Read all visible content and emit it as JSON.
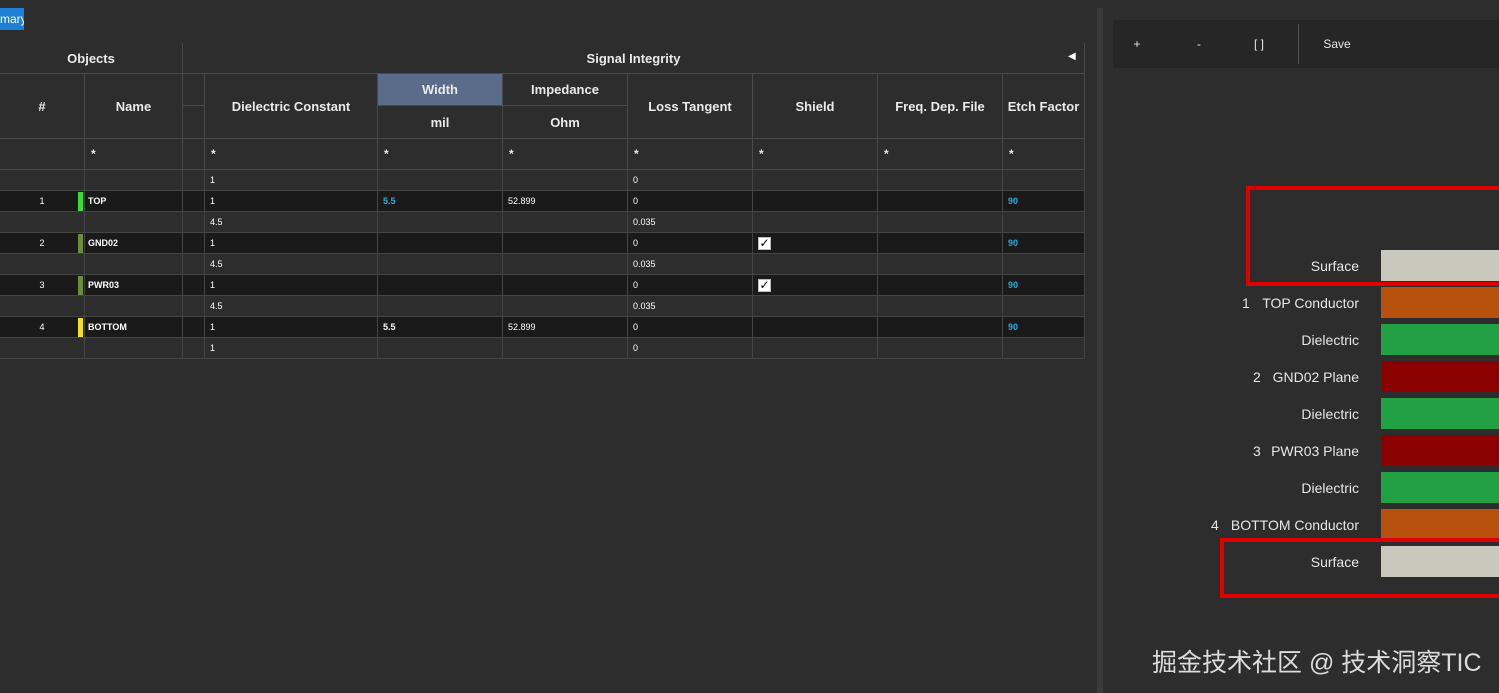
{
  "tab_label": "mary",
  "grid": {
    "group_objects": "Objects",
    "group_signal": "Signal Integrity",
    "col_num": "#",
    "col_name": "Name",
    "col_dk": "Dielectric Constant",
    "col_width": "Width",
    "col_width_unit": "mil",
    "col_imp": "Impedance",
    "col_imp_unit": "Ohm",
    "col_loss": "Loss Tangent",
    "col_shield": "Shield",
    "col_freq": "Freq. Dep. File",
    "col_etch": "Etch Factor",
    "filter": "*",
    "rows": [
      {
        "num": "",
        "name": "",
        "dk": "1",
        "width": "",
        "imp": "",
        "loss": "0",
        "etch": ""
      },
      {
        "num": "1",
        "name": "TOP",
        "dk": "1",
        "width": "5.5",
        "imp": "52.899",
        "loss": "0",
        "etch": "90"
      },
      {
        "num": "",
        "name": "",
        "dk": "4.5",
        "width": "",
        "imp": "",
        "loss": "0.035",
        "etch": ""
      },
      {
        "num": "2",
        "name": "GND02",
        "dk": "1",
        "width": "",
        "imp": "",
        "loss": "0",
        "etch": "90"
      },
      {
        "num": "",
        "name": "",
        "dk": "4.5",
        "width": "",
        "imp": "",
        "loss": "0.035",
        "etch": ""
      },
      {
        "num": "3",
        "name": "PWR03",
        "dk": "1",
        "width": "",
        "imp": "",
        "loss": "0",
        "etch": "90"
      },
      {
        "num": "",
        "name": "",
        "dk": "4.5",
        "width": "",
        "imp": "",
        "loss": "0.035",
        "etch": ""
      },
      {
        "num": "4",
        "name": "BOTTOM",
        "dk": "1",
        "width": "5.5",
        "imp": "52.899",
        "loss": "0",
        "etch": "90"
      },
      {
        "num": "",
        "name": "",
        "dk": "1",
        "width": "",
        "imp": "",
        "loss": "0",
        "etch": ""
      }
    ],
    "collapse_icon": "triangle-left-icon",
    "check_mark": "✓"
  },
  "toolbar": {
    "plus": "+",
    "minus": "-",
    "brackets": "[ ]",
    "save": "Save"
  },
  "layers": [
    {
      "idx": "",
      "label": "Surface",
      "color": "#c8c8bc"
    },
    {
      "idx": "1",
      "label": "TOP Conductor",
      "color": "#b8510e"
    },
    {
      "idx": "",
      "label": "Dielectric",
      "color": "#21a143"
    },
    {
      "idx": "2",
      "label": "GND02 Plane",
      "color": "#8b0000"
    },
    {
      "idx": "",
      "label": "Dielectric",
      "color": "#21a143"
    },
    {
      "idx": "3",
      "label": "PWR03 Plane",
      "color": "#8b0000"
    },
    {
      "idx": "",
      "label": "Dielectric",
      "color": "#21a143"
    },
    {
      "idx": "4",
      "label": "BOTTOM Conductor",
      "color": "#b8510e"
    },
    {
      "idx": "",
      "label": "Surface",
      "color": "#c8c8bc"
    }
  ],
  "watermark": "掘金技术社区 @ 技术洞察TIC",
  "colors": {
    "accent": "#1e7fd6",
    "highlight_box": "#e00000",
    "top_swatch": "#3ddc3d",
    "inner_swatch": "#6b8e3a",
    "bottom_swatch": "#f0e020"
  }
}
